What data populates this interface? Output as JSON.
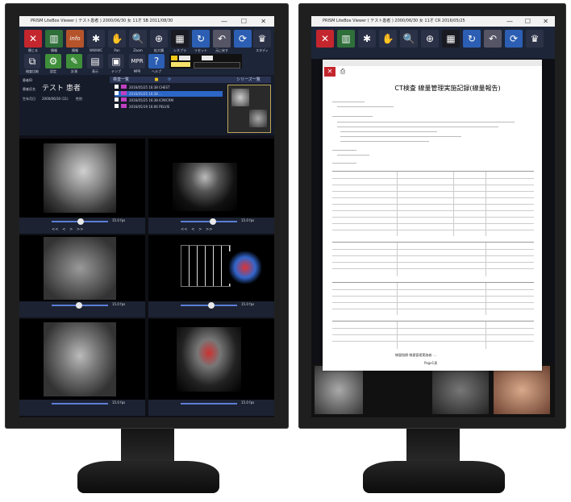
{
  "left_monitor": {
    "window_title": "PRISM LiteBox Viewer ( テスト患者 ) 2000/06/30 女 11才 SB 2011/08/30",
    "toolbar": [
      {
        "label": "閉じる",
        "icon": "close-icon"
      },
      {
        "label": "情報",
        "icon": "grid-icon"
      },
      {
        "label": "情報",
        "icon": "info-icon"
      },
      {
        "label": "WW/WC",
        "icon": "sun-icon"
      },
      {
        "label": "Pan",
        "icon": "hand-icon"
      },
      {
        "label": "Zoom",
        "icon": "zoom-icon"
      },
      {
        "label": "拡大鏡",
        "icon": "magnifier-icon"
      },
      {
        "label": "シネプラ",
        "icon": "cine-icon"
      },
      {
        "label": "リセット",
        "icon": "reset-icon"
      },
      {
        "label": "元に戻す",
        "icon": "undo-icon"
      },
      {
        "label": "回転",
        "icon": "rotate-icon"
      },
      {
        "label": "スタディ",
        "icon": "study-icon"
      }
    ],
    "toolbar2": [
      {
        "label": "検査比較",
        "icon": "compare-icon"
      },
      {
        "label": "設定",
        "icon": "gear-icon"
      },
      {
        "label": "計測",
        "icon": "ruler-icon"
      },
      {
        "label": "表示",
        "icon": "display-icon"
      },
      {
        "label": "テンプ",
        "icon": "template-icon"
      },
      {
        "label": "MPR",
        "icon": "mpr-icon"
      },
      {
        "label": "ヘルプ",
        "icon": "help-icon"
      }
    ],
    "patient": {
      "id_label": "患者ID",
      "name_label": "患者氏名",
      "name_value": "テスト 患者",
      "birth_label": "生年月日",
      "birth_value": "2000/06/30 (11)",
      "sex_label": "性別"
    },
    "study_list_header": "検査一覧",
    "series_list_header": "シリーズ一覧",
    "studies": [
      "2016/05/25 16:38 CHEST",
      "2016/05/25 16:38 ...",
      "2016/05/25 16:38 ICM/CRM",
      "2016/05/19 16:06 PELVIS"
    ],
    "fps": "15.0 fps"
  },
  "right_monitor": {
    "window_title": "PRISM LiteBox Viewer ( テスト患者 ) 2000/06/30 女 11才 CR 2016/05/25",
    "report_title": "CT検査 線量管理実施記録(線量報告)",
    "footer": "Page1頁",
    "report_footnote": "線量指標 線量管理実施者: ..."
  }
}
